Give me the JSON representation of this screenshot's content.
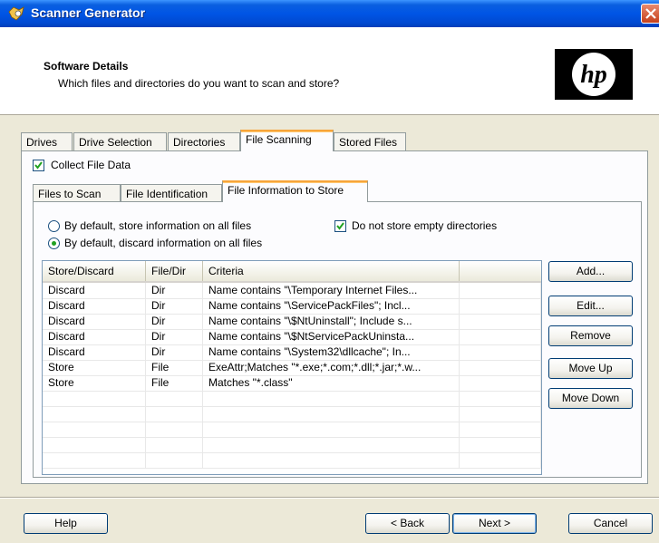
{
  "window": {
    "title": "Scanner Generator",
    "close_icon": "close-icon"
  },
  "header": {
    "title": "Software Details",
    "subtitle": "Which files and directories do you want to scan and store?",
    "logo_text": "hp"
  },
  "main_tabs": [
    {
      "label": "Drives",
      "active": false
    },
    {
      "label": "Drive Selection",
      "active": false
    },
    {
      "label": "Directories",
      "active": false
    },
    {
      "label": "File Scanning",
      "active": true
    },
    {
      "label": "Stored Files",
      "active": false
    }
  ],
  "collect_file_data": {
    "label": "Collect File Data",
    "checked": true
  },
  "sub_tabs": [
    {
      "label": "Files to Scan",
      "active": false
    },
    {
      "label": "File Identification",
      "active": false
    },
    {
      "label": "File Information to Store",
      "active": true
    }
  ],
  "options": {
    "radio_store": {
      "label": "By default, store information on all files",
      "selected": false
    },
    "radio_discard": {
      "label": "By default, discard information on all files",
      "selected": true
    },
    "empty_dirs": {
      "label": "Do not store empty directories",
      "checked": true
    }
  },
  "table": {
    "columns": [
      "Store/Discard",
      "File/Dir",
      "Criteria",
      ""
    ],
    "rows": [
      [
        "Discard",
        "Dir",
        "Name contains \"\\Temporary Internet Files..."
      ],
      [
        "Discard",
        "Dir",
        "Name contains \"\\ServicePackFiles\"; Incl..."
      ],
      [
        "Discard",
        "Dir",
        "Name contains \"\\$NtUninstall\"; Include s..."
      ],
      [
        "Discard",
        "Dir",
        "Name contains \"\\$NtServicePackUninsta..."
      ],
      [
        "Discard",
        "Dir",
        "Name contains \"\\System32\\dllcache\"; In..."
      ],
      [
        "Store",
        "File",
        "ExeAttr;Matches \"*.exe;*.com;*.dll;*.jar;*.w..."
      ],
      [
        "Store",
        "File",
        "Matches \"*.class\""
      ]
    ]
  },
  "side_buttons": {
    "add": "Add...",
    "edit": "Edit...",
    "remove": "Remove",
    "move_up": "Move Up",
    "move_down": "Move Down"
  },
  "footer": {
    "help": "Help",
    "back": "< Back",
    "next": "Next >",
    "cancel": "Cancel"
  },
  "colors": {
    "titlebar": "#0055e5",
    "active_tab_accent": "#f7a53a",
    "dialog_bg": "#ece9d8",
    "check_green": "#21a121"
  }
}
